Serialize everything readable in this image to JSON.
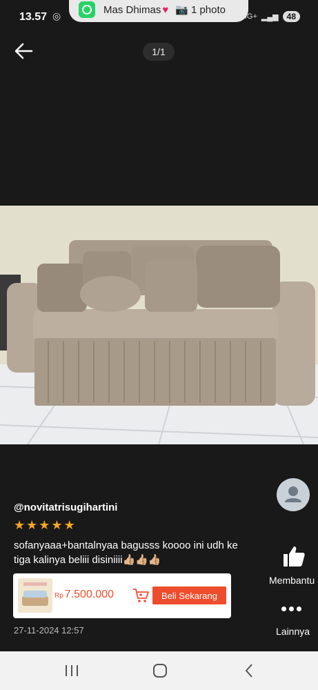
{
  "status_bar": {
    "time": "13.57",
    "network": "4G+",
    "battery": "48"
  },
  "notification": {
    "app_icon": "whatsapp-icon",
    "sender": "Mas Dhimas",
    "message": "1 photo"
  },
  "viewer": {
    "counter": "1/1"
  },
  "review": {
    "username": "@novitatrisugihartini",
    "rating": 5,
    "text": "sofanyaaa+bantalnyaa bagusss koooo ini udh ke tiga kalinya beliii disiniiii👍🏼👍🏼👍🏼",
    "date": "27-11-2024 12:57"
  },
  "product": {
    "currency": "Rp",
    "price": "7.500.000",
    "buy_label": "Beli Sekarang"
  },
  "actions": {
    "helpful_label": "Membantu",
    "more_label": "Lainnya"
  },
  "colors": {
    "accent": "#ee4d2d",
    "star": "#f5a623",
    "background": "#191919"
  }
}
